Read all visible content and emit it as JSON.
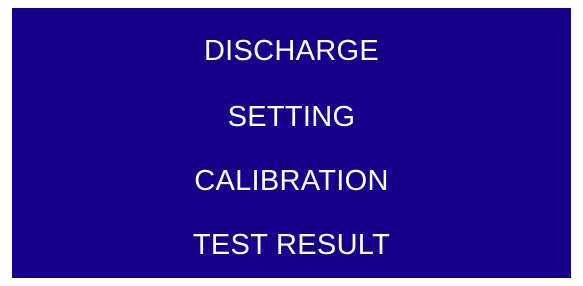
{
  "screen": {
    "background_color": "#16008a",
    "text_color": "#ffffff"
  },
  "menu": {
    "items": [
      {
        "label": "DISCHARGE"
      },
      {
        "label": "SETTING"
      },
      {
        "label": "CALIBRATION"
      },
      {
        "label": "TEST RESULT"
      }
    ]
  }
}
